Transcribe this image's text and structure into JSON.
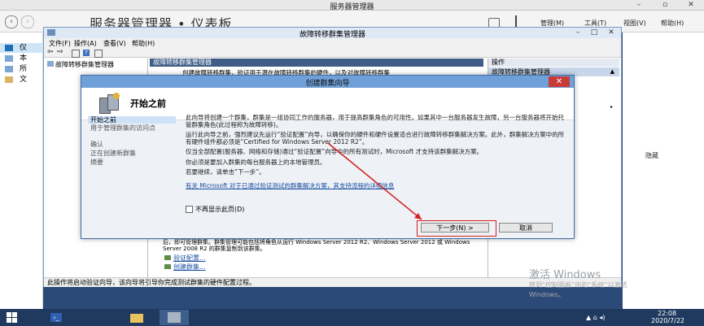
{
  "server_manager": {
    "title": "服务器管理器",
    "header": "服务器管理器 • 仪表板",
    "menus": [
      "管理(M)",
      "工具(T)",
      "视图(V)",
      "帮助(H)"
    ],
    "nav_items": [
      "仪",
      "本",
      "所",
      "文"
    ],
    "right_panel_hide": "隐藏"
  },
  "fcm": {
    "title": "故障转移群集管理器",
    "menus": [
      "文件(F)",
      "操作(A)",
      "查看(V)",
      "帮助(H)"
    ],
    "tree_root": "故障转移群集管理器",
    "center_header": "故障转移群集管理器",
    "center_text_top": "创建故障转移群集，验证用于潜在故障转移群集的硬件，以及对故障转移群集",
    "center_text_bottom": "后，即可管理群集。群集管理可能包括将角色从运行 Windows Server 2012 R2、Windows Server 2012 或 Windows Server 2008 R2 的群集复制到该群集。",
    "links": [
      "验证配置...",
      "创建群集..."
    ],
    "actions_header": "操作",
    "actions_subheader": "故障转移群集管理器",
    "status": "此操作将启动验证向导，该向导将引导你完成测试群集的硬件配置过程。"
  },
  "wizard": {
    "title": "创建群集向导",
    "heading": "开始之前",
    "steps": [
      "开始之前",
      "用于管理群集的访问点",
      "确认",
      "正在创建新群集",
      "摘要"
    ],
    "paragraphs": [
      "此向导将创建一个群集，群集是一组协同工作的服务器，用于提高群集角色的可用性。如果其中一台服务器发生故障，另一台服务器将开始托管群集角色(此过程称为故障转移)。",
      "运行此向导之前，强烈建议先运行“验证配置”向导，以确保你的硬件和硬件设置适合进行故障转移群集解决方案。此外，群集解决方案中的所有硬件组件都必须是“Certified for Windows Server 2012 R2”。",
      "仅当全部配置(服务器、网络和存储)通过“验证配置”向导中的所有测试时，Microsoft 才支持该群集解决方案。",
      "你必须是要加入群集的每台服务器上的本地管理员。",
      "若要继续，请单击“下一步”。"
    ],
    "link": "有关 Microsoft 对于已通过验证测试的群集解决方案，其支持流程的详细信息",
    "checkbox_label": "不再显示此页(D)",
    "next_button": "下一步(N) >",
    "cancel_button": "取消"
  },
  "watermark": {
    "line1": "激活 Windows",
    "line2": "转到“控制面板”中的“系统”以激活",
    "line3": "Windows。"
  },
  "taskbar": {
    "time": "22:08",
    "date": "2020/7/22"
  }
}
